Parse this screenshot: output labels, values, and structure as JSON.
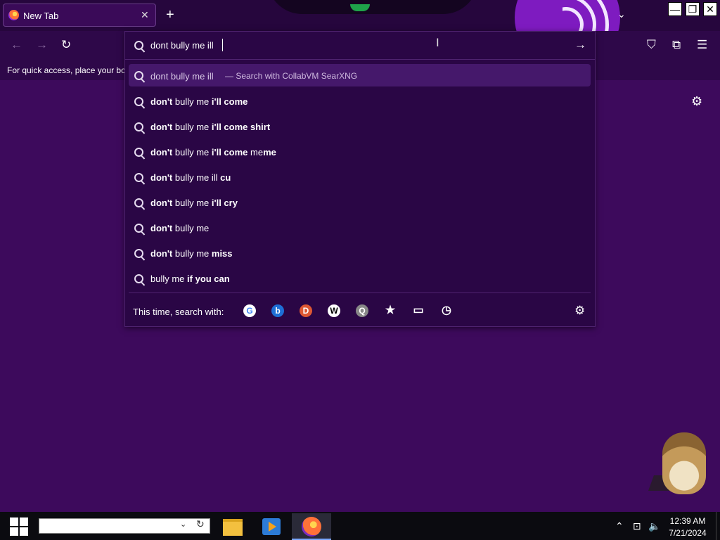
{
  "browser": {
    "tab": {
      "title": "New Tab",
      "close": "✕"
    },
    "new_tab": "+",
    "tab_list": "⌄",
    "window_buttons": {
      "minimize": "—",
      "restore": "❐",
      "close": "✕"
    },
    "bookmarks_text": "For quick access, place your bookmarks here",
    "icons": [
      "back-arrow-icon",
      "forward-arrow-icon",
      "reload-icon",
      "pocket-icon",
      "extensions-icon",
      "menu-icon",
      "settings-icon"
    ]
  },
  "urlbar": {
    "value": "dont bully me ill",
    "heuristic": {
      "text": "dont bully me ill",
      "action": "— Search with CollabVM SearXNG"
    },
    "suggestions": [
      {
        "parts": [
          {
            "t": "don't",
            "b": true
          },
          {
            "t": " bully me ",
            "b": false
          },
          {
            "t": "i'll come",
            "b": true
          }
        ]
      },
      {
        "parts": [
          {
            "t": "don't",
            "b": true
          },
          {
            "t": " bully me ",
            "b": false
          },
          {
            "t": "i'll come shirt",
            "b": true
          }
        ]
      },
      {
        "parts": [
          {
            "t": "don't",
            "b": true
          },
          {
            "t": " bully me ",
            "b": false
          },
          {
            "t": "i'll come",
            "b": true
          },
          {
            "t": " me",
            "b": false
          },
          {
            "t": "me",
            "b": true
          }
        ]
      },
      {
        "parts": [
          {
            "t": "don't",
            "b": true
          },
          {
            "t": " bully me ill ",
            "b": false
          },
          {
            "t": "cu",
            "b": true
          }
        ]
      },
      {
        "parts": [
          {
            "t": "don't",
            "b": true
          },
          {
            "t": " bully me ",
            "b": false
          },
          {
            "t": "i'll cry",
            "b": true
          }
        ]
      },
      {
        "parts": [
          {
            "t": "don't",
            "b": true
          },
          {
            "t": " bully me",
            "b": false
          }
        ]
      },
      {
        "parts": [
          {
            "t": "don't",
            "b": true
          },
          {
            "t": " bully me ",
            "b": false
          },
          {
            "t": "miss",
            "b": true
          }
        ]
      },
      {
        "parts": [
          {
            "t": "bully me ",
            "b": false
          },
          {
            "t": "if you can",
            "b": true
          }
        ]
      }
    ],
    "one_off_label": "This time, search with:",
    "engines": [
      {
        "name": "google-icon",
        "glyph": "G",
        "color": "#4285f4",
        "bg": "#ffffff"
      },
      {
        "name": "bing-icon",
        "glyph": "b",
        "color": "#ffffff",
        "bg": "#1e6fd6"
      },
      {
        "name": "duckduckgo-icon",
        "glyph": "D",
        "color": "#ffffff",
        "bg": "#de5833"
      },
      {
        "name": "wikipedia-icon",
        "glyph": "W",
        "color": "#000000",
        "bg": "#ffffff"
      },
      {
        "name": "searxng-icon",
        "glyph": "Q",
        "color": "#ffffff",
        "bg": "#888888"
      },
      {
        "name": "bookmarks-icon",
        "glyph": "★",
        "color": "#ffffff",
        "bg": "transparent"
      },
      {
        "name": "tabs-icon",
        "glyph": "▭",
        "color": "#ffffff",
        "bg": "transparent"
      },
      {
        "name": "history-icon",
        "glyph": "◷",
        "color": "#ffffff",
        "bg": "transparent"
      }
    ]
  },
  "taskbar": {
    "time": "12:39 AM",
    "date": "7/21/2024",
    "apps": [
      "file-explorer-icon",
      "media-player-icon",
      "firefox-icon"
    ]
  },
  "colors": {
    "accent": "#3d0a5c",
    "popup": "#2a0645",
    "highlight": "#45186b"
  }
}
